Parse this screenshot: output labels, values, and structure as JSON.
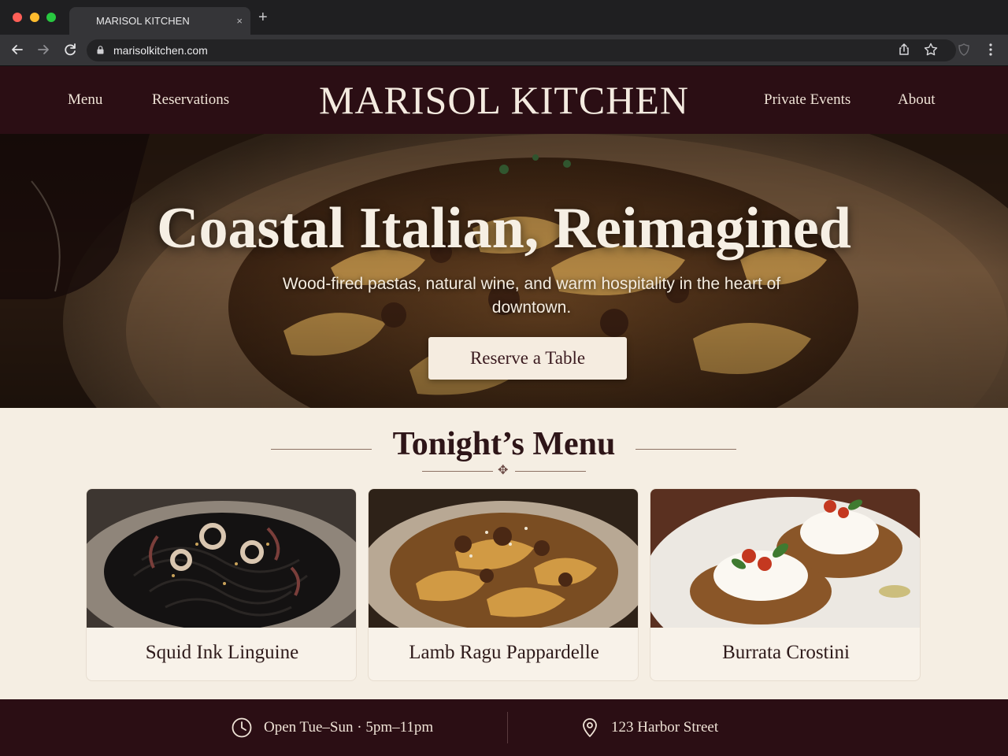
{
  "browser": {
    "tab_title": "MARISOL KITCHEN",
    "tab_close": "×",
    "new_tab": "+",
    "url": "marisolkitchen.com"
  },
  "header": {
    "brand": "MARISOL KITCHEN",
    "nav_left": [
      "Menu",
      "Reservations"
    ],
    "nav_right": [
      "Private Events",
      "About"
    ]
  },
  "hero": {
    "title": "Coastal Italian, Reimagined",
    "subtitle": "Wood-fired pastas, natural wine, and warm hospitality in the heart of downtown.",
    "cta": "Reserve a Table"
  },
  "menu": {
    "title": "Tonight’s Menu",
    "ornament": "✥",
    "items": [
      {
        "name": "Squid Ink Linguine"
      },
      {
        "name": "Lamb Ragu Pappardelle"
      },
      {
        "name": "Burrata Crostini"
      }
    ]
  },
  "footer": {
    "hours": "Open Tue–Sun · 5pm–11pm",
    "address": "123 Harbor Street"
  },
  "colors": {
    "header_bg": "#2b0e14",
    "section_bg": "#f5eee3",
    "cream": "#f5ece0"
  }
}
